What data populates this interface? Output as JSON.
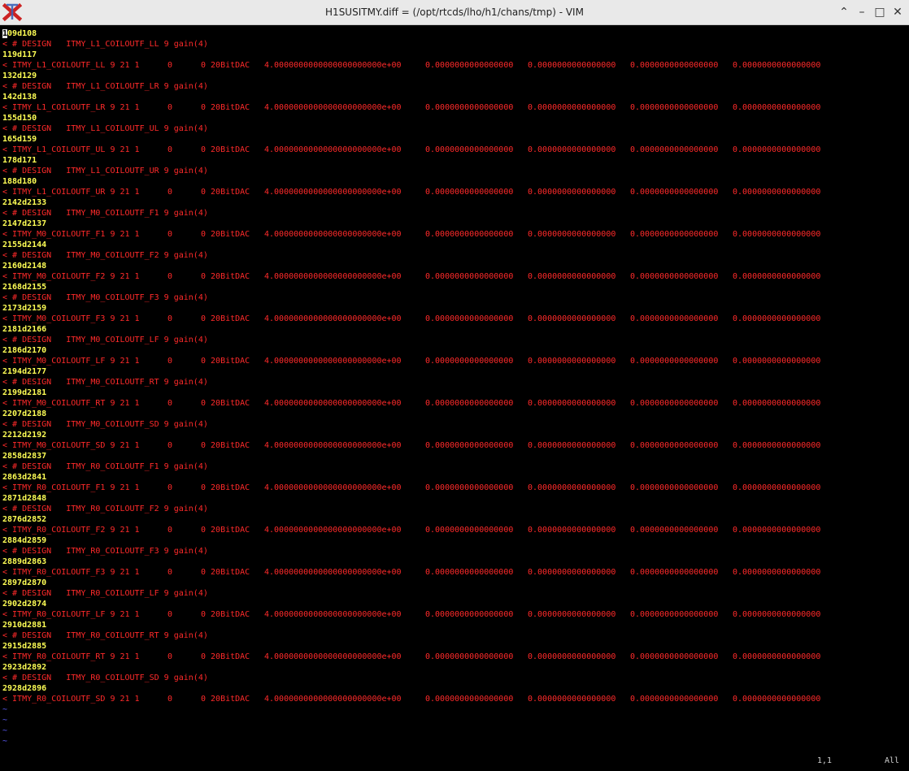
{
  "window": {
    "title": "H1SUSITMY.diff = (/opt/rtcds/lho/h1/chans/tmp) - VIM",
    "controls": {
      "pin": "⌃",
      "minimize": "–",
      "maximize": "□",
      "close": "✕"
    }
  },
  "editor": {
    "diff_lines": [
      {
        "kind": "hunk",
        "text": "109d108"
      },
      {
        "kind": "rem",
        "head": "< # DESIGN   ITMY_L1_COILOUTF_LL 9 gain(4)"
      },
      {
        "kind": "hunk",
        "text": "119d117"
      },
      {
        "kind": "rem",
        "head": "< ITMY_L1_COILOUTF_LL 9 21 1",
        "c1": "0",
        "c2": "0 20BitDAC",
        "c3": "4.0000000000000000000000e+00",
        "c4": "0.0000000000000000",
        "c5": "0.0000000000000000",
        "c6": "0.0000000000000000",
        "c7": "0.0000000000000000"
      },
      {
        "kind": "hunk",
        "text": "132d129"
      },
      {
        "kind": "rem",
        "head": "< # DESIGN   ITMY_L1_COILOUTF_LR 9 gain(4)"
      },
      {
        "kind": "hunk",
        "text": "142d138"
      },
      {
        "kind": "rem",
        "head": "< ITMY_L1_COILOUTF_LR 9 21 1",
        "c1": "0",
        "c2": "0 20BitDAC",
        "c3": "4.0000000000000000000000e+00",
        "c4": "0.0000000000000000",
        "c5": "0.0000000000000000",
        "c6": "0.0000000000000000",
        "c7": "0.0000000000000000"
      },
      {
        "kind": "hunk",
        "text": "155d150"
      },
      {
        "kind": "rem",
        "head": "< # DESIGN   ITMY_L1_COILOUTF_UL 9 gain(4)"
      },
      {
        "kind": "hunk",
        "text": "165d159"
      },
      {
        "kind": "rem",
        "head": "< ITMY_L1_COILOUTF_UL 9 21 1",
        "c1": "0",
        "c2": "0 20BitDAC",
        "c3": "4.0000000000000000000000e+00",
        "c4": "0.0000000000000000",
        "c5": "0.0000000000000000",
        "c6": "0.0000000000000000",
        "c7": "0.0000000000000000"
      },
      {
        "kind": "hunk",
        "text": "178d171"
      },
      {
        "kind": "rem",
        "head": "< # DESIGN   ITMY_L1_COILOUTF_UR 9 gain(4)"
      },
      {
        "kind": "hunk",
        "text": "188d180"
      },
      {
        "kind": "rem",
        "head": "< ITMY_L1_COILOUTF_UR 9 21 1",
        "c1": "0",
        "c2": "0 20BitDAC",
        "c3": "4.0000000000000000000000e+00",
        "c4": "0.0000000000000000",
        "c5": "0.0000000000000000",
        "c6": "0.0000000000000000",
        "c7": "0.0000000000000000"
      },
      {
        "kind": "hunk",
        "text": "2142d2133"
      },
      {
        "kind": "rem",
        "head": "< # DESIGN   ITMY_M0_COILOUTF_F1 9 gain(4)"
      },
      {
        "kind": "hunk",
        "text": "2147d2137"
      },
      {
        "kind": "rem",
        "head": "< ITMY_M0_COILOUTF_F1 9 21 1",
        "c1": "0",
        "c2": "0 20BitDAC",
        "c3": "4.0000000000000000000000e+00",
        "c4": "0.0000000000000000",
        "c5": "0.0000000000000000",
        "c6": "0.0000000000000000",
        "c7": "0.0000000000000000"
      },
      {
        "kind": "hunk",
        "text": "2155d2144"
      },
      {
        "kind": "rem",
        "head": "< # DESIGN   ITMY_M0_COILOUTF_F2 9 gain(4)"
      },
      {
        "kind": "hunk",
        "text": "2160d2148"
      },
      {
        "kind": "rem",
        "head": "< ITMY_M0_COILOUTF_F2 9 21 1",
        "c1": "0",
        "c2": "0 20BitDAC",
        "c3": "4.0000000000000000000000e+00",
        "c4": "0.0000000000000000",
        "c5": "0.0000000000000000",
        "c6": "0.0000000000000000",
        "c7": "0.0000000000000000"
      },
      {
        "kind": "hunk",
        "text": "2168d2155"
      },
      {
        "kind": "rem",
        "head": "< # DESIGN   ITMY_M0_COILOUTF_F3 9 gain(4)"
      },
      {
        "kind": "hunk",
        "text": "2173d2159"
      },
      {
        "kind": "rem",
        "head": "< ITMY_M0_COILOUTF_F3 9 21 1",
        "c1": "0",
        "c2": "0 20BitDAC",
        "c3": "4.0000000000000000000000e+00",
        "c4": "0.0000000000000000",
        "c5": "0.0000000000000000",
        "c6": "0.0000000000000000",
        "c7": "0.0000000000000000"
      },
      {
        "kind": "hunk",
        "text": "2181d2166"
      },
      {
        "kind": "rem",
        "head": "< # DESIGN   ITMY_M0_COILOUTF_LF 9 gain(4)"
      },
      {
        "kind": "hunk",
        "text": "2186d2170"
      },
      {
        "kind": "rem",
        "head": "< ITMY_M0_COILOUTF_LF 9 21 1",
        "c1": "0",
        "c2": "0 20BitDAC",
        "c3": "4.0000000000000000000000e+00",
        "c4": "0.0000000000000000",
        "c5": "0.0000000000000000",
        "c6": "0.0000000000000000",
        "c7": "0.0000000000000000"
      },
      {
        "kind": "hunk",
        "text": "2194d2177"
      },
      {
        "kind": "rem",
        "head": "< # DESIGN   ITMY_M0_COILOUTF_RT 9 gain(4)"
      },
      {
        "kind": "hunk",
        "text": "2199d2181"
      },
      {
        "kind": "rem",
        "head": "< ITMY_M0_COILOUTF_RT 9 21 1",
        "c1": "0",
        "c2": "0 20BitDAC",
        "c3": "4.0000000000000000000000e+00",
        "c4": "0.0000000000000000",
        "c5": "0.0000000000000000",
        "c6": "0.0000000000000000",
        "c7": "0.0000000000000000"
      },
      {
        "kind": "hunk",
        "text": "2207d2188"
      },
      {
        "kind": "rem",
        "head": "< # DESIGN   ITMY_M0_COILOUTF_SD 9 gain(4)"
      },
      {
        "kind": "hunk",
        "text": "2212d2192"
      },
      {
        "kind": "rem",
        "head": "< ITMY_M0_COILOUTF_SD 9 21 1",
        "c1": "0",
        "c2": "0 20BitDAC",
        "c3": "4.0000000000000000000000e+00",
        "c4": "0.0000000000000000",
        "c5": "0.0000000000000000",
        "c6": "0.0000000000000000",
        "c7": "0.0000000000000000"
      },
      {
        "kind": "hunk",
        "text": "2858d2837"
      },
      {
        "kind": "rem",
        "head": "< # DESIGN   ITMY_R0_COILOUTF_F1 9 gain(4)"
      },
      {
        "kind": "hunk",
        "text": "2863d2841"
      },
      {
        "kind": "rem",
        "head": "< ITMY_R0_COILOUTF_F1 9 21 1",
        "c1": "0",
        "c2": "0 20BitDAC",
        "c3": "4.0000000000000000000000e+00",
        "c4": "0.0000000000000000",
        "c5": "0.0000000000000000",
        "c6": "0.0000000000000000",
        "c7": "0.0000000000000000"
      },
      {
        "kind": "hunk",
        "text": "2871d2848"
      },
      {
        "kind": "rem",
        "head": "< # DESIGN   ITMY_R0_COILOUTF_F2 9 gain(4)"
      },
      {
        "kind": "hunk",
        "text": "2876d2852"
      },
      {
        "kind": "rem",
        "head": "< ITMY_R0_COILOUTF_F2 9 21 1",
        "c1": "0",
        "c2": "0 20BitDAC",
        "c3": "4.0000000000000000000000e+00",
        "c4": "0.0000000000000000",
        "c5": "0.0000000000000000",
        "c6": "0.0000000000000000",
        "c7": "0.0000000000000000"
      },
      {
        "kind": "hunk",
        "text": "2884d2859"
      },
      {
        "kind": "rem",
        "head": "< # DESIGN   ITMY_R0_COILOUTF_F3 9 gain(4)"
      },
      {
        "kind": "hunk",
        "text": "2889d2863"
      },
      {
        "kind": "rem",
        "head": "< ITMY_R0_COILOUTF_F3 9 21 1",
        "c1": "0",
        "c2": "0 20BitDAC",
        "c3": "4.0000000000000000000000e+00",
        "c4": "0.0000000000000000",
        "c5": "0.0000000000000000",
        "c6": "0.0000000000000000",
        "c7": "0.0000000000000000"
      },
      {
        "kind": "hunk",
        "text": "2897d2870"
      },
      {
        "kind": "rem",
        "head": "< # DESIGN   ITMY_R0_COILOUTF_LF 9 gain(4)"
      },
      {
        "kind": "hunk",
        "text": "2902d2874"
      },
      {
        "kind": "rem",
        "head": "< ITMY_R0_COILOUTF_LF 9 21 1",
        "c1": "0",
        "c2": "0 20BitDAC",
        "c3": "4.0000000000000000000000e+00",
        "c4": "0.0000000000000000",
        "c5": "0.0000000000000000",
        "c6": "0.0000000000000000",
        "c7": "0.0000000000000000"
      },
      {
        "kind": "hunk",
        "text": "2910d2881"
      },
      {
        "kind": "rem",
        "head": "< # DESIGN   ITMY_R0_COILOUTF_RT 9 gain(4)"
      },
      {
        "kind": "hunk",
        "text": "2915d2885"
      },
      {
        "kind": "rem",
        "head": "< ITMY_R0_COILOUTF_RT 9 21 1",
        "c1": "0",
        "c2": "0 20BitDAC",
        "c3": "4.0000000000000000000000e+00",
        "c4": "0.0000000000000000",
        "c5": "0.0000000000000000",
        "c6": "0.0000000000000000",
        "c7": "0.0000000000000000"
      },
      {
        "kind": "hunk",
        "text": "2923d2892"
      },
      {
        "kind": "rem",
        "head": "< # DESIGN   ITMY_R0_COILOUTF_SD 9 gain(4)"
      },
      {
        "kind": "hunk",
        "text": "2928d2896"
      },
      {
        "kind": "rem",
        "head": "< ITMY_R0_COILOUTF_SD 9 21 1",
        "c1": "0",
        "c2": "0 20BitDAC",
        "c3": "4.0000000000000000000000e+00",
        "c4": "0.0000000000000000",
        "c5": "0.0000000000000000",
        "c6": "0.0000000000000000",
        "c7": "0.0000000000000000"
      },
      {
        "kind": "tilde",
        "text": "~"
      },
      {
        "kind": "tilde",
        "text": "~"
      },
      {
        "kind": "tilde",
        "text": "~"
      },
      {
        "kind": "tilde",
        "text": "~"
      }
    ],
    "status": {
      "ruler": "1,1",
      "position": "All"
    }
  },
  "colors": {
    "hunk": "#ffff55",
    "removed": "#ff2a2a",
    "empty_line_tilde": "#5f5fff",
    "background": "#000000"
  },
  "icons": {
    "app": "xvim-app-icon"
  }
}
